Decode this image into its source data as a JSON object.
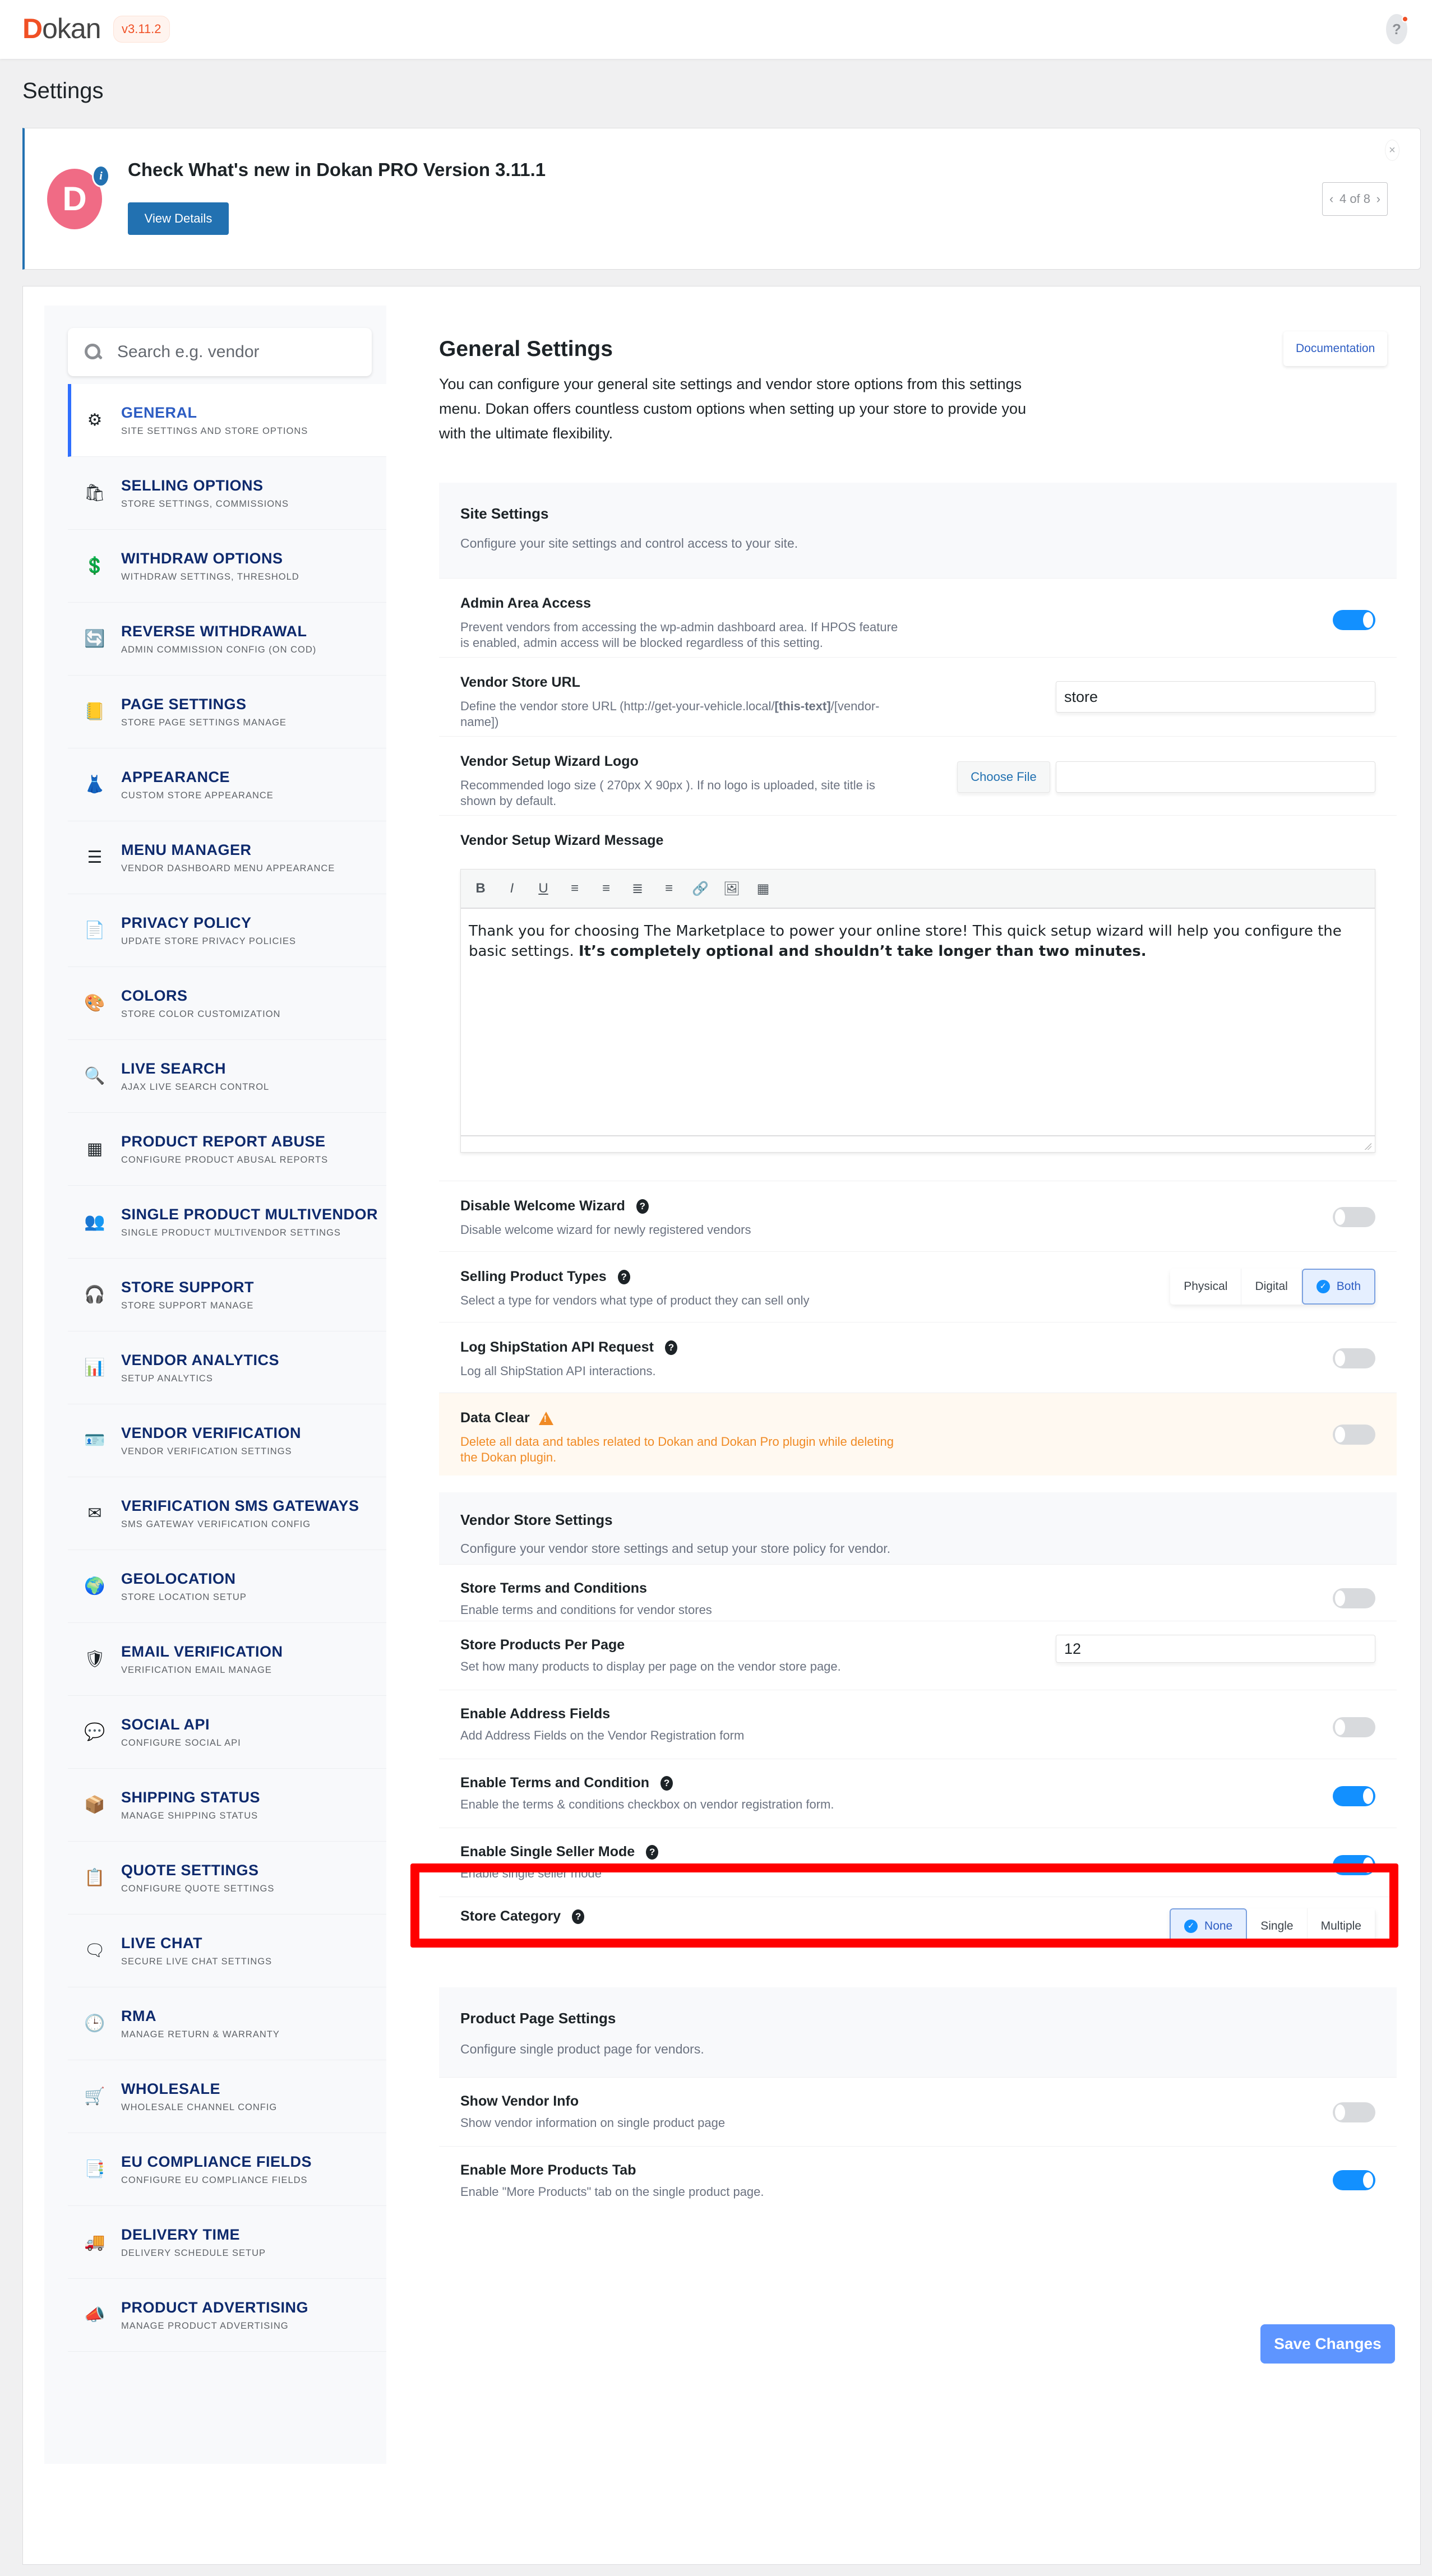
{
  "topbar": {
    "logo_initial": "D",
    "logo_rest": "okan",
    "version": "v3.11.2",
    "help_label": "?"
  },
  "page_title": "Settings",
  "notice": {
    "avatar_letter": "D",
    "info_glyph": "i",
    "title": "Check What's new in Dokan PRO Version 3.11.1",
    "button": "View Details",
    "close": "×",
    "pager_prev": "‹",
    "pager_text": "4 of 8",
    "pager_next": "›"
  },
  "sidebar": {
    "search_placeholder": "Search e.g. vendor",
    "items": [
      {
        "title": "GENERAL",
        "sub": "SITE SETTINGS AND STORE OPTIONS",
        "icon": "⚙",
        "active": true
      },
      {
        "title": "SELLING OPTIONS",
        "sub": "STORE SETTINGS, COMMISSIONS",
        "icon": "🛍"
      },
      {
        "title": "WITHDRAW OPTIONS",
        "sub": "WITHDRAW SETTINGS, THRESHOLD",
        "icon": "💲"
      },
      {
        "title": "REVERSE WITHDRAWAL",
        "sub": "ADMIN COMMISSION CONFIG (ON COD)",
        "icon": "🔄"
      },
      {
        "title": "PAGE SETTINGS",
        "sub": "STORE PAGE SETTINGS MANAGE",
        "icon": "📒"
      },
      {
        "title": "APPEARANCE",
        "sub": "CUSTOM STORE APPEARANCE",
        "icon": "👗"
      },
      {
        "title": "MENU MANAGER",
        "sub": "VENDOR DASHBOARD MENU APPEARANCE",
        "icon": "☰"
      },
      {
        "title": "PRIVACY POLICY",
        "sub": "UPDATE STORE PRIVACY POLICIES",
        "icon": "📄"
      },
      {
        "title": "COLORS",
        "sub": "STORE COLOR CUSTOMIZATION",
        "icon": "🎨"
      },
      {
        "title": "LIVE SEARCH",
        "sub": "AJAX LIVE SEARCH CONTROL",
        "icon": "🔍"
      },
      {
        "title": "PRODUCT REPORT ABUSE",
        "sub": "CONFIGURE PRODUCT ABUSAL REPORTS",
        "icon": "▦"
      },
      {
        "title": "SINGLE PRODUCT MULTIVENDOR",
        "sub": "SINGLE PRODUCT MULTIVENDOR SETTINGS",
        "icon": "👥"
      },
      {
        "title": "STORE SUPPORT",
        "sub": "STORE SUPPORT MANAGE",
        "icon": "🎧"
      },
      {
        "title": "VENDOR ANALYTICS",
        "sub": "SETUP ANALYTICS",
        "icon": "📊"
      },
      {
        "title": "VENDOR VERIFICATION",
        "sub": "VENDOR VERIFICATION SETTINGS",
        "icon": "🪪"
      },
      {
        "title": "VERIFICATION SMS GATEWAYS",
        "sub": "SMS GATEWAY VERIFICATION CONFIG",
        "icon": "✉"
      },
      {
        "title": "GEOLOCATION",
        "sub": "STORE LOCATION SETUP",
        "icon": "🌍"
      },
      {
        "title": "EMAIL VERIFICATION",
        "sub": "VERIFICATION EMAIL MANAGE",
        "icon": "🛡"
      },
      {
        "title": "SOCIAL API",
        "sub": "CONFIGURE SOCIAL API",
        "icon": "💬"
      },
      {
        "title": "SHIPPING STATUS",
        "sub": "MANAGE SHIPPING STATUS",
        "icon": "📦"
      },
      {
        "title": "QUOTE SETTINGS",
        "sub": "CONFIGURE QUOTE SETTINGS",
        "icon": "📋"
      },
      {
        "title": "LIVE CHAT",
        "sub": "SECURE LIVE CHAT SETTINGS",
        "icon": "🗨"
      },
      {
        "title": "RMA",
        "sub": "MANAGE RETURN & WARRANTY",
        "icon": "🕒"
      },
      {
        "title": "WHOLESALE",
        "sub": "WHOLESALE CHANNEL CONFIG",
        "icon": "🛒"
      },
      {
        "title": "EU COMPLIANCE FIELDS",
        "sub": "CONFIGURE EU COMPLIANCE FIELDS",
        "icon": "📑"
      },
      {
        "title": "DELIVERY TIME",
        "sub": "DELIVERY SCHEDULE SETUP",
        "icon": "🚚"
      },
      {
        "title": "PRODUCT ADVERTISING",
        "sub": "MANAGE PRODUCT ADVERTISING",
        "icon": "📣"
      }
    ]
  },
  "content": {
    "title": "General Settings",
    "documentation": "Documentation",
    "description": "You can configure your general site settings and vendor store options from this settings menu. Dokan offers countless custom options when setting up your store to provide you with the ultimate flexibility.",
    "site_settings": {
      "title": "Site Settings",
      "desc": "Configure your site settings and control access to your site.",
      "admin_area": {
        "title": "Admin Area Access",
        "desc": "Prevent vendors from accessing the wp-admin dashboard area. If HPOS feature is enabled, admin access will be blocked regardless of this setting.",
        "enabled": true
      },
      "store_url": {
        "title": "Vendor Store URL",
        "desc_pre": "Define the vendor store URL (http://get-your-vehicle.local/",
        "desc_bold": "[this-text]",
        "desc_post": "/[vendor-name])",
        "value": "store"
      },
      "wizard_logo": {
        "title": "Vendor Setup Wizard Logo",
        "desc": "Recommended logo size ( 270px X 90px ). If no logo is uploaded, site title is shown by default.",
        "button": "Choose File",
        "value": ""
      },
      "wizard_message": {
        "title": "Vendor Setup Wizard Message",
        "toolbar": [
          "B",
          "I",
          "U",
          "≡",
          "≡",
          "≣",
          "≡",
          "🔗",
          "🖼",
          "▦"
        ],
        "text": "Thank you for choosing The Marketplace to power your online store! This quick setup wizard will help you configure the basic settings. ",
        "text_bold": "It’s completely optional and shouldn’t take longer than two minutes."
      },
      "disable_wizard": {
        "title": "Disable Welcome Wizard",
        "desc": "Disable welcome wizard for newly registered vendors",
        "enabled": false
      },
      "product_types": {
        "title": "Selling Product Types",
        "desc": "Select a type for vendors what type of product they can sell only",
        "options": [
          "Physical",
          "Digital",
          "Both"
        ],
        "selected": "Both"
      },
      "shipstation": {
        "title": "Log ShipStation API Request",
        "desc": "Log all ShipStation API interactions.",
        "enabled": false
      },
      "data_clear": {
        "title": "Data Clear",
        "desc": "Delete all data and tables related to Dokan and Dokan Pro plugin while deleting the Dokan plugin.",
        "enabled": false,
        "accent": "#f08a24"
      }
    },
    "vendor_store": {
      "title": "Vendor Store Settings",
      "desc": "Configure your vendor store settings and setup your store policy for vendor.",
      "terms": {
        "title": "Store Terms and Conditions",
        "desc": "Enable terms and conditions for vendor stores",
        "enabled": false
      },
      "per_page": {
        "title": "Store Products Per Page",
        "desc": "Set how many products to display per page on the vendor store page.",
        "value": "12"
      },
      "address": {
        "title": "Enable Address Fields",
        "desc": "Add Address Fields on the Vendor Registration form",
        "enabled": false
      },
      "terms_condition": {
        "title": "Enable Terms and Condition",
        "desc": "Enable the terms & conditions checkbox on vendor registration form.",
        "enabled": true
      },
      "single_seller": {
        "title": "Enable Single Seller Mode",
        "desc": "Enable single seller mode",
        "enabled": true
      },
      "category": {
        "title": "Store Category",
        "options": [
          "None",
          "Single",
          "Multiple"
        ],
        "selected": "None"
      }
    },
    "product_page": {
      "title": "Product Page Settings",
      "desc": "Configure single product page for vendors.",
      "vendor_info": {
        "title": "Show Vendor Info",
        "desc": "Show vendor information on single product page",
        "enabled": false
      },
      "more_products": {
        "title": "Enable More Products Tab",
        "desc": "Enable \"More Products\" tab on the single product page.",
        "enabled": true
      }
    },
    "save": "Save Changes"
  },
  "colors": {
    "accent": "#2f6fff",
    "toggle_on": "#1290ff",
    "save": "#5e95ff",
    "highlight": "#ff0000",
    "brand": "#f05025"
  }
}
